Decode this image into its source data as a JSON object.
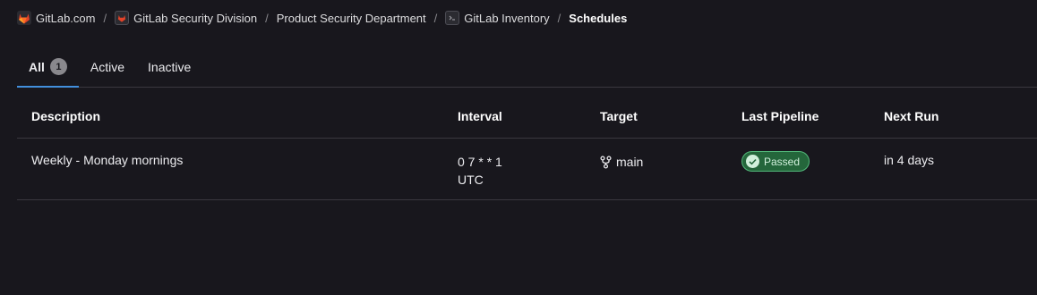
{
  "breadcrumb": {
    "items": [
      {
        "label": "GitLab.com",
        "icon": "gitlab-tanuki-icon"
      },
      {
        "label": "GitLab Security Division",
        "icon": "group-icon"
      },
      {
        "label": "Product Security Department"
      },
      {
        "label": "GitLab Inventory",
        "icon": "project-icon"
      },
      {
        "label": "Schedules"
      }
    ],
    "separator": "/"
  },
  "tabs": [
    {
      "label": "All",
      "count": "1",
      "active": true
    },
    {
      "label": "Active"
    },
    {
      "label": "Inactive"
    }
  ],
  "table": {
    "headers": {
      "description": "Description",
      "interval": "Interval",
      "target": "Target",
      "last_pipeline": "Last Pipeline",
      "next_run": "Next Run"
    },
    "rows": [
      {
        "description": "Weekly - Monday mornings",
        "interval_cron": "0 7 * * 1",
        "interval_tz": "UTC",
        "target": "main",
        "target_icon": "branch-icon",
        "last_pipeline": "Passed",
        "next_run": "in 4 days"
      }
    ]
  },
  "colors": {
    "background": "#18171d",
    "tab_active_underline": "#428fdc",
    "status_passed_bg": "#24663b",
    "status_passed_border": "#52b87a",
    "gitlab_orange": "#e24329"
  }
}
